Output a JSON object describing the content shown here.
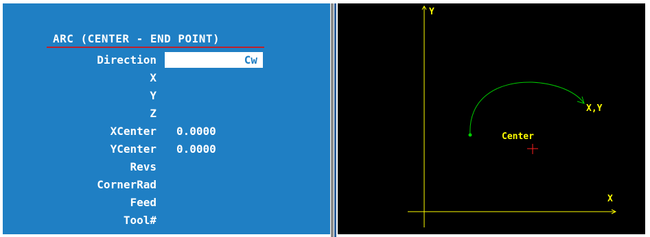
{
  "form": {
    "title": "ARC (CENTER - END POINT)",
    "fields": [
      {
        "label": "Direction",
        "value": "Cw"
      },
      {
        "label": "X",
        "value": ""
      },
      {
        "label": "Y",
        "value": ""
      },
      {
        "label": "Z",
        "value": ""
      },
      {
        "label": "XCenter",
        "value": "0.0000"
      },
      {
        "label": "YCenter",
        "value": "0.0000"
      },
      {
        "label": "Revs",
        "value": ""
      },
      {
        "label": "CornerRad",
        "value": ""
      },
      {
        "label": "Feed",
        "value": ""
      },
      {
        "label": "Tool#",
        "value": ""
      }
    ]
  },
  "diagram": {
    "y_axis_label": "Y",
    "x_axis_label": "X",
    "end_point_label": "X,Y",
    "center_label": "Center",
    "colors": {
      "axis": "#ffff00",
      "arc": "#00cc00",
      "center_marker": "#ff2020",
      "form_bg": "#1f7fc4",
      "title_underline": "#c0202a"
    }
  }
}
